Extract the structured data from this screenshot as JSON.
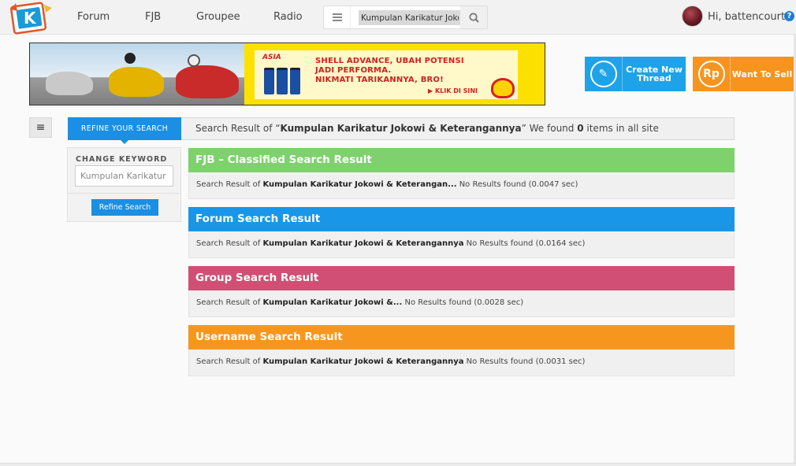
{
  "nav": {
    "items": [
      "Forum",
      "FJB",
      "Groupee",
      "Radio"
    ],
    "search_value": "Kumpulan Karikatur Jokowi & Keterangannya",
    "user_greeting": "Hi, battencourt",
    "help": "?"
  },
  "banner": {
    "headline_1": "SHELL ADVANCE, UBAH POTENSI",
    "headline_2": "JADI PERFORMA.",
    "headline_3": "NIKMATI TARIKANNYA, BRO!",
    "cta": "KLIK DI SINI",
    "asia_logo": "ASIA"
  },
  "actions": {
    "create_thread": "Create New Thread",
    "want_to_sell": "Want To Sell",
    "sell_icon": "Rp"
  },
  "sidebar": {
    "refine_tab": "REFINE YOUR SEARCH",
    "change_keyword": "CHANGE KEYWORD",
    "keyword_value": "Kumpulan Karikatur Jokowi & Keterangannya",
    "refine_button": "Refine Search"
  },
  "summary": {
    "prefix": "Search Result of “",
    "query": "Kumpulan Karikatur Jokowi & Keterangannya",
    "mid": "” We found ",
    "count": "0",
    "suffix": " items in all site"
  },
  "results": {
    "fjb": {
      "title": "FJB – Classified Search Result",
      "prefix": "Search Result of ",
      "query": "Kumpulan Karikatur Jokowi & Keterangan...",
      "status": " No Results found (0.0047 sec)"
    },
    "forum": {
      "title": "Forum Search Result",
      "prefix": "Search Result of ",
      "query": "Kumpulan Karikatur Jokowi & Keterangannya",
      "status": " No Results found (0.0164 sec)"
    },
    "group": {
      "title": "Group Search Result",
      "prefix": "Search Result of ",
      "query": "Kumpulan Karikatur Jokowi &...",
      "status": " No Results found (0.0028 sec)"
    },
    "user": {
      "title": "Username Search Result",
      "prefix": "Search Result of ",
      "query": "Kumpulan Karikatur Jokowi & Keterangannya",
      "status": " No Results found (0.0031 sec)"
    }
  },
  "colors": {
    "fjb": "#7ed16d",
    "forum": "#1a96e8",
    "group": "#d14f74",
    "user": "#f7961f",
    "accent": "#1a8fe3"
  }
}
